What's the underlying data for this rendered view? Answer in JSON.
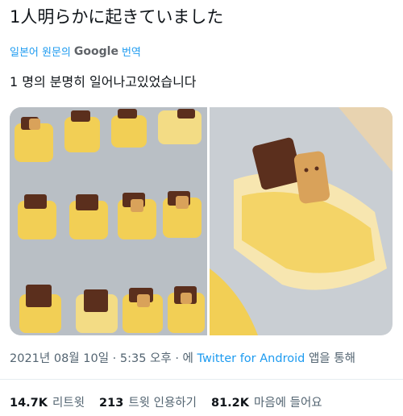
{
  "tweet": {
    "text": "1人明らかに起きていました",
    "translate_prefix": "일본어 원문의",
    "translate_brand": "Google",
    "translate_suffix": "번역",
    "translated_text": "1 명의 분명히 일어나고있었습니다"
  },
  "meta": {
    "timestamp": "2021년 08월 10일 · 5:35 오후 · 에",
    "source_link": "Twitter for Android",
    "source_suffix": "앱을 통해"
  },
  "stats": {
    "retweets_count": "14.7K",
    "retweets_label": "리트윗",
    "quotes_count": "213",
    "quotes_label": "트윗 인용하기",
    "likes_count": "81.2K",
    "likes_label": "마음에 들어요"
  },
  "colors": {
    "link": "#1d9bf0",
    "secondary_text": "#536471",
    "pastry": "#f2cf55",
    "chocolate": "#5b2f1d",
    "biscuit": "#d9a25a",
    "tray": "#bfc5cb"
  }
}
